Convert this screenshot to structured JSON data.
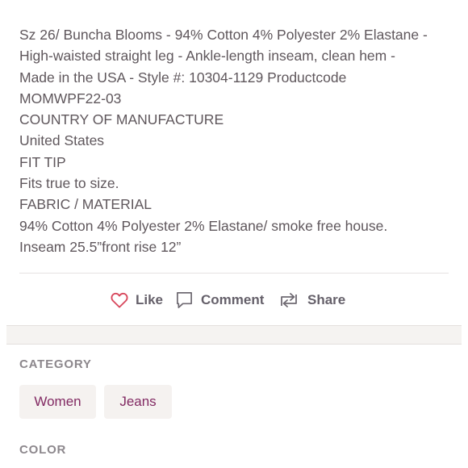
{
  "description": {
    "lines": [
      "Sz 26/ Buncha Blooms - 94% Cotton 4% Polyester 2% Elastane -",
      "High-waisted straight leg - Ankle-length inseam, clean hem -",
      "Made in the USA - Style #: 10304-1129 Productcode",
      "MOMWPF22-03",
      "COUNTRY OF MANUFACTURE",
      "United States",
      "FIT TIP",
      "Fits true to size.",
      "FABRIC / MATERIAL",
      "94% Cotton 4% Polyester 2% Elastane/ smoke free house.",
      "Inseam 25.5”front rise 12”"
    ]
  },
  "actions": {
    "like_label": "Like",
    "comment_label": "Comment",
    "share_label": "Share",
    "like_icon": "heart-icon",
    "comment_icon": "comment-bubble-icon",
    "share_icon": "share-arrows-icon"
  },
  "category": {
    "heading": "CATEGORY",
    "chips": [
      "Women",
      "Jeans"
    ]
  },
  "color": {
    "heading": "COLOR"
  },
  "colors": {
    "like_heart": "#d8475c",
    "chip_text": "#822a63",
    "chip_bg": "#f5f2f0",
    "body_text": "#5f575c",
    "section_label": "#8c878c"
  }
}
